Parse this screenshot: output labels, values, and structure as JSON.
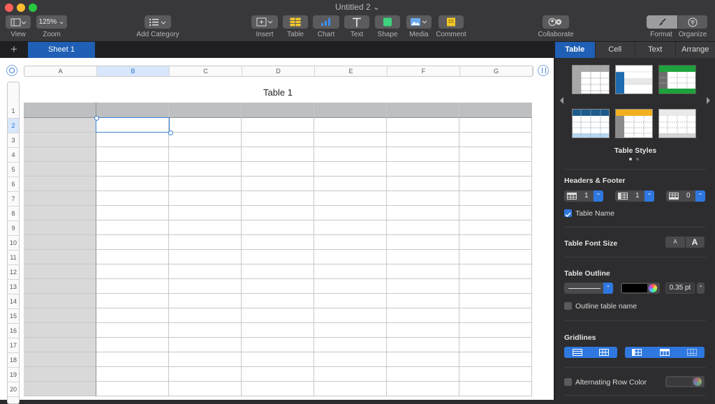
{
  "window": {
    "title": "Untitled 2 ⌄"
  },
  "toolbar": {
    "view_label": "View",
    "zoom_value": "125% ⌄",
    "zoom_label": "Zoom",
    "add_category_label": "Add Category",
    "insert_label": "Insert",
    "table_label": "Table",
    "chart_label": "Chart",
    "text_label": "Text",
    "shape_label": "Shape",
    "media_label": "Media",
    "comment_label": "Comment",
    "collaborate_label": "Collaborate",
    "format_label": "Format",
    "organize_label": "Organize"
  },
  "sheets": {
    "add": "+",
    "active": "Sheet 1"
  },
  "table": {
    "title": "Table 1",
    "columns": [
      "A",
      "B",
      "C",
      "D",
      "E",
      "F",
      "G"
    ],
    "rows": [
      "1",
      "2",
      "3",
      "4",
      "5",
      "6",
      "7",
      "8",
      "9",
      "10",
      "11",
      "12",
      "13",
      "14",
      "15",
      "16",
      "17",
      "18",
      "19",
      "20"
    ],
    "selected_column": "B",
    "selected_row": "2"
  },
  "inspector": {
    "tabs": [
      "Table",
      "Cell",
      "Text",
      "Arrange"
    ],
    "active_tab": "Table",
    "styles_label": "Table Styles",
    "headers_footer": {
      "label": "Headers & Footer",
      "header_rows": "1",
      "header_columns": "1",
      "footer_rows": "0"
    },
    "table_name_label": "Table Name",
    "font_size": {
      "label": "Table Font Size",
      "smaller": "A",
      "larger": "A"
    },
    "outline": {
      "label": "Table Outline",
      "width": "0.35 pt",
      "color": "#000000"
    },
    "outline_name_label": "Outline table name",
    "gridlines_label": "Gridlines",
    "alt_row_label": "Alternating Row Color"
  },
  "colors": {
    "accent": "#2e78e0",
    "sheet_tab": "#1f5fb5",
    "header_row": "#bdbfc1",
    "header_col": "#d9d9d9"
  }
}
